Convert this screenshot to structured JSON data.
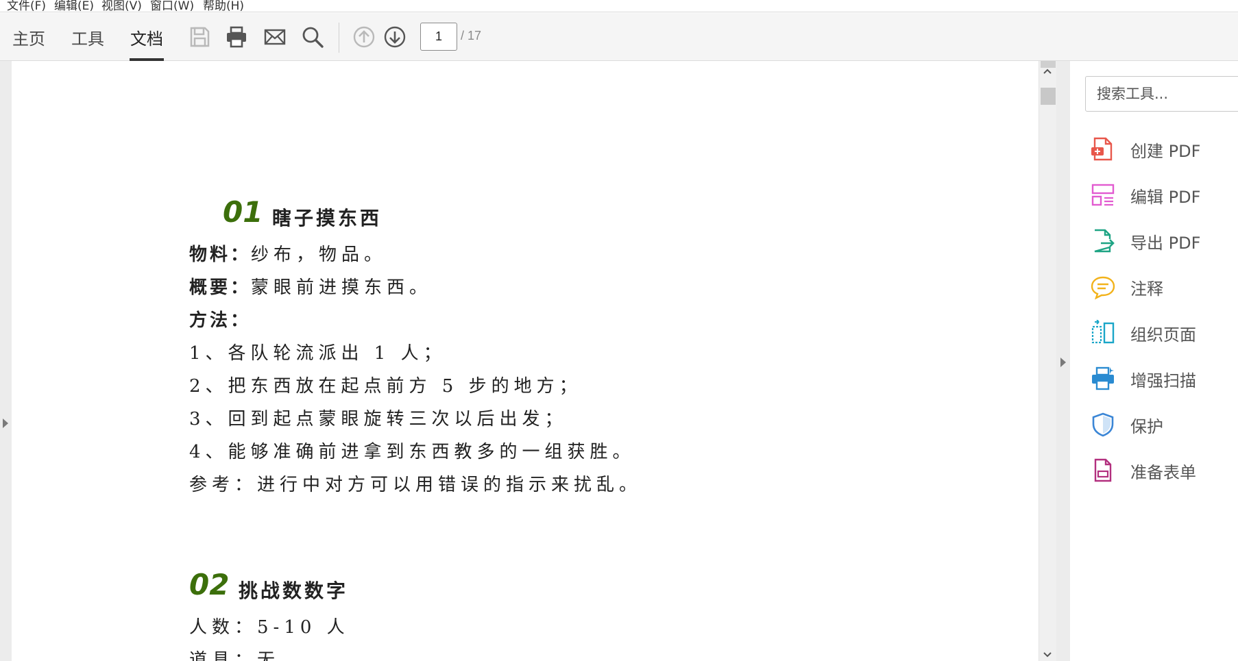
{
  "menu": [
    "文件(F)",
    "编辑(E)",
    "视图(V)",
    "窗口(W)",
    "帮助(H)"
  ],
  "tabs": {
    "home": "主页",
    "tools": "工具",
    "document": "文档"
  },
  "pager": {
    "current": "1",
    "total": "/ 17"
  },
  "document": {
    "s1": {
      "num": "01",
      "title": "瞎子摸东西",
      "lines": [
        {
          "label": "物料：",
          "text": "纱布，物品。"
        },
        {
          "label": "概要：",
          "text": "蒙眼前进摸东西。"
        },
        {
          "label": "方法：",
          "text": ""
        },
        {
          "label": "",
          "text": "1、各队轮流派出 1 人；"
        },
        {
          "label": "",
          "text": "2、把东西放在起点前方 5 步的地方；"
        },
        {
          "label": "",
          "text": "3、回到起点蒙眼旋转三次以后出发；"
        },
        {
          "label": "",
          "text": "4、能够准确前进拿到东西教多的一组获胜。"
        },
        {
          "label": "",
          "text": "参考：进行中对方可以用错误的指示来扰乱。"
        }
      ]
    },
    "s2": {
      "num": "02",
      "title": "挑战数数字",
      "lines": [
        {
          "label": "",
          "text": "人数：5-10 人"
        },
        {
          "label": "",
          "text": "道具：无"
        }
      ]
    }
  },
  "right_panel": {
    "search_placeholder": "搜索工具...",
    "tools": [
      {
        "label": "创建 PDF",
        "icon": "create-pdf-icon",
        "color": "#e8574b"
      },
      {
        "label": "编辑 PDF",
        "icon": "edit-pdf-icon",
        "color": "#e25bd0"
      },
      {
        "label": "导出 PDF",
        "icon": "export-pdf-icon",
        "color": "#1ea484"
      },
      {
        "label": "注释",
        "icon": "comment-icon",
        "color": "#f2b21a"
      },
      {
        "label": "组织页面",
        "icon": "organize-pages-icon",
        "color": "#1aa6c8"
      },
      {
        "label": "增强扫描",
        "icon": "enhance-scan-icon",
        "color": "#2a8bd1"
      },
      {
        "label": "保护",
        "icon": "protect-icon",
        "color": "#3b86d6"
      },
      {
        "label": "准备表单",
        "icon": "prepare-form-icon",
        "color": "#b22f7e"
      }
    ]
  }
}
